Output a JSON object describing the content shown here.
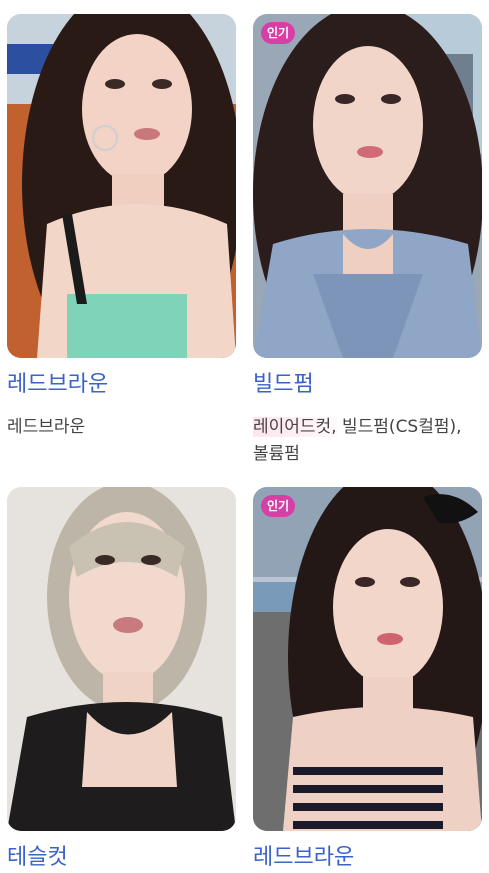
{
  "colors": {
    "badge": "#d53fa6",
    "title": "#3a62c8",
    "desc": "#444444"
  },
  "cards": [
    {
      "title": "레드브라운",
      "desc": "레드브라운",
      "badge": ""
    },
    {
      "title": "빌드펌",
      "desc_highlight": "레이어드컷,",
      "desc_rest": " 빌드펌(CS컬펌), 볼륨펌",
      "badge": "인기"
    },
    {
      "title": "테슬컷",
      "desc": "",
      "badge": ""
    },
    {
      "title": "레드브라운",
      "desc": "",
      "badge": "인기"
    }
  ]
}
